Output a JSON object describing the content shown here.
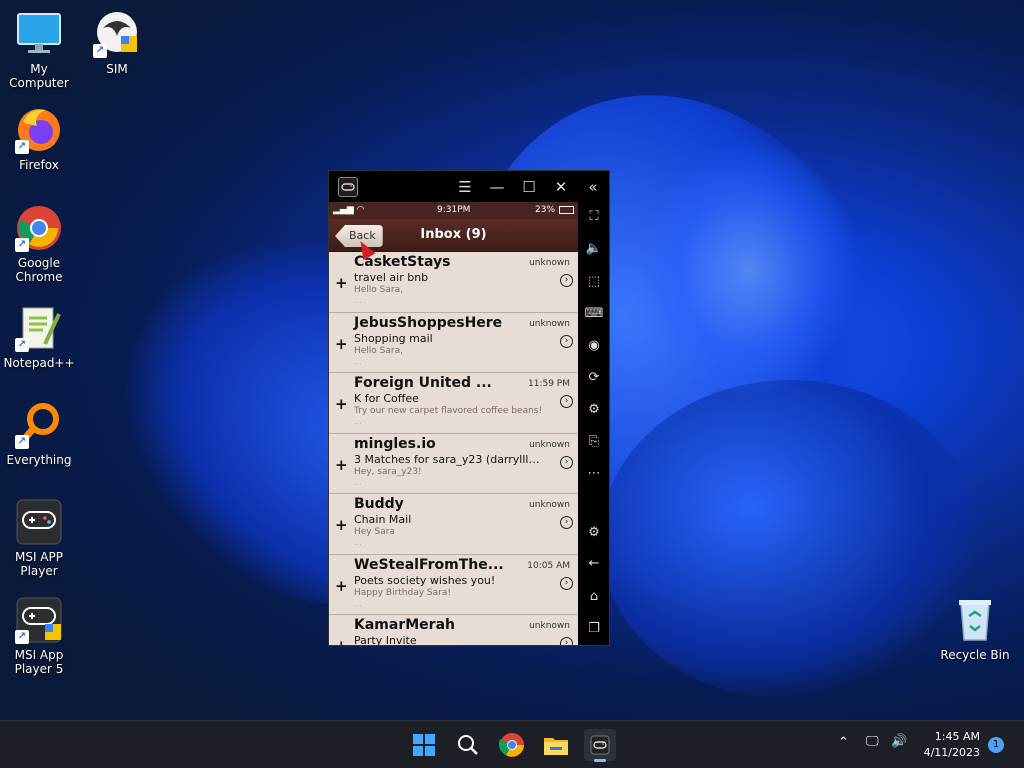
{
  "desktop": {
    "icons": [
      {
        "label": "My Computer"
      },
      {
        "label": "SIM"
      },
      {
        "label": "Firefox"
      },
      {
        "label": "Google Chrome"
      },
      {
        "label": "Notepad++"
      },
      {
        "label": "Everything"
      },
      {
        "label": "MSI APP Player"
      },
      {
        "label": "MSI App Player 5"
      },
      {
        "label": "Recycle Bin"
      }
    ],
    "shortcut_glyph": "↗"
  },
  "emulator": {
    "status": {
      "time": "9:31PM",
      "battery": "23%"
    },
    "nav": {
      "back_label": "Back",
      "title": "Inbox (9)"
    },
    "emails": [
      {
        "sender": "CasketStays",
        "date": "unknown",
        "subject": "travel air bnb",
        "preview": "Hello Sara,",
        "more": "..."
      },
      {
        "sender": "JebusShoppesHere",
        "date": "unknown",
        "subject": "Shopping mail",
        "preview": "Hello Sara,",
        "more": "..."
      },
      {
        "sender": " Foreign United ...",
        "date": "11:59 PM",
        "subject": "K for Coffee",
        "preview": "Try our new carpet flavored coffee beans!",
        "more": "..."
      },
      {
        "sender": "mingles.io",
        "date": "unknown",
        "subject": "3 Matches for sara_y23 (darrylll31, ...",
        "preview": "Hey, sara_y23!",
        "more": "..."
      },
      {
        "sender": "Buddy",
        "date": "unknown",
        "subject": "Chain Mail",
        "preview": "Hey Sara",
        "more": "..."
      },
      {
        "sender": "WeStealFromThe...",
        "date": "10:05 AM",
        "subject": "Poets society wishes you!",
        "preview": "Happy Birthday Sara!",
        "more": "..."
      },
      {
        "sender": "KamarMerah",
        "date": "unknown",
        "subject": "Party Invite",
        "preview": "",
        "more": ""
      }
    ]
  },
  "taskbar": {
    "clock_time": "1:45 AM",
    "clock_date": "4/11/2023",
    "notification_count": "1"
  },
  "colors": {
    "inbox_bg": "#e8ddd4",
    "navbar": "#4a2420",
    "accent": "#1a5cff"
  }
}
